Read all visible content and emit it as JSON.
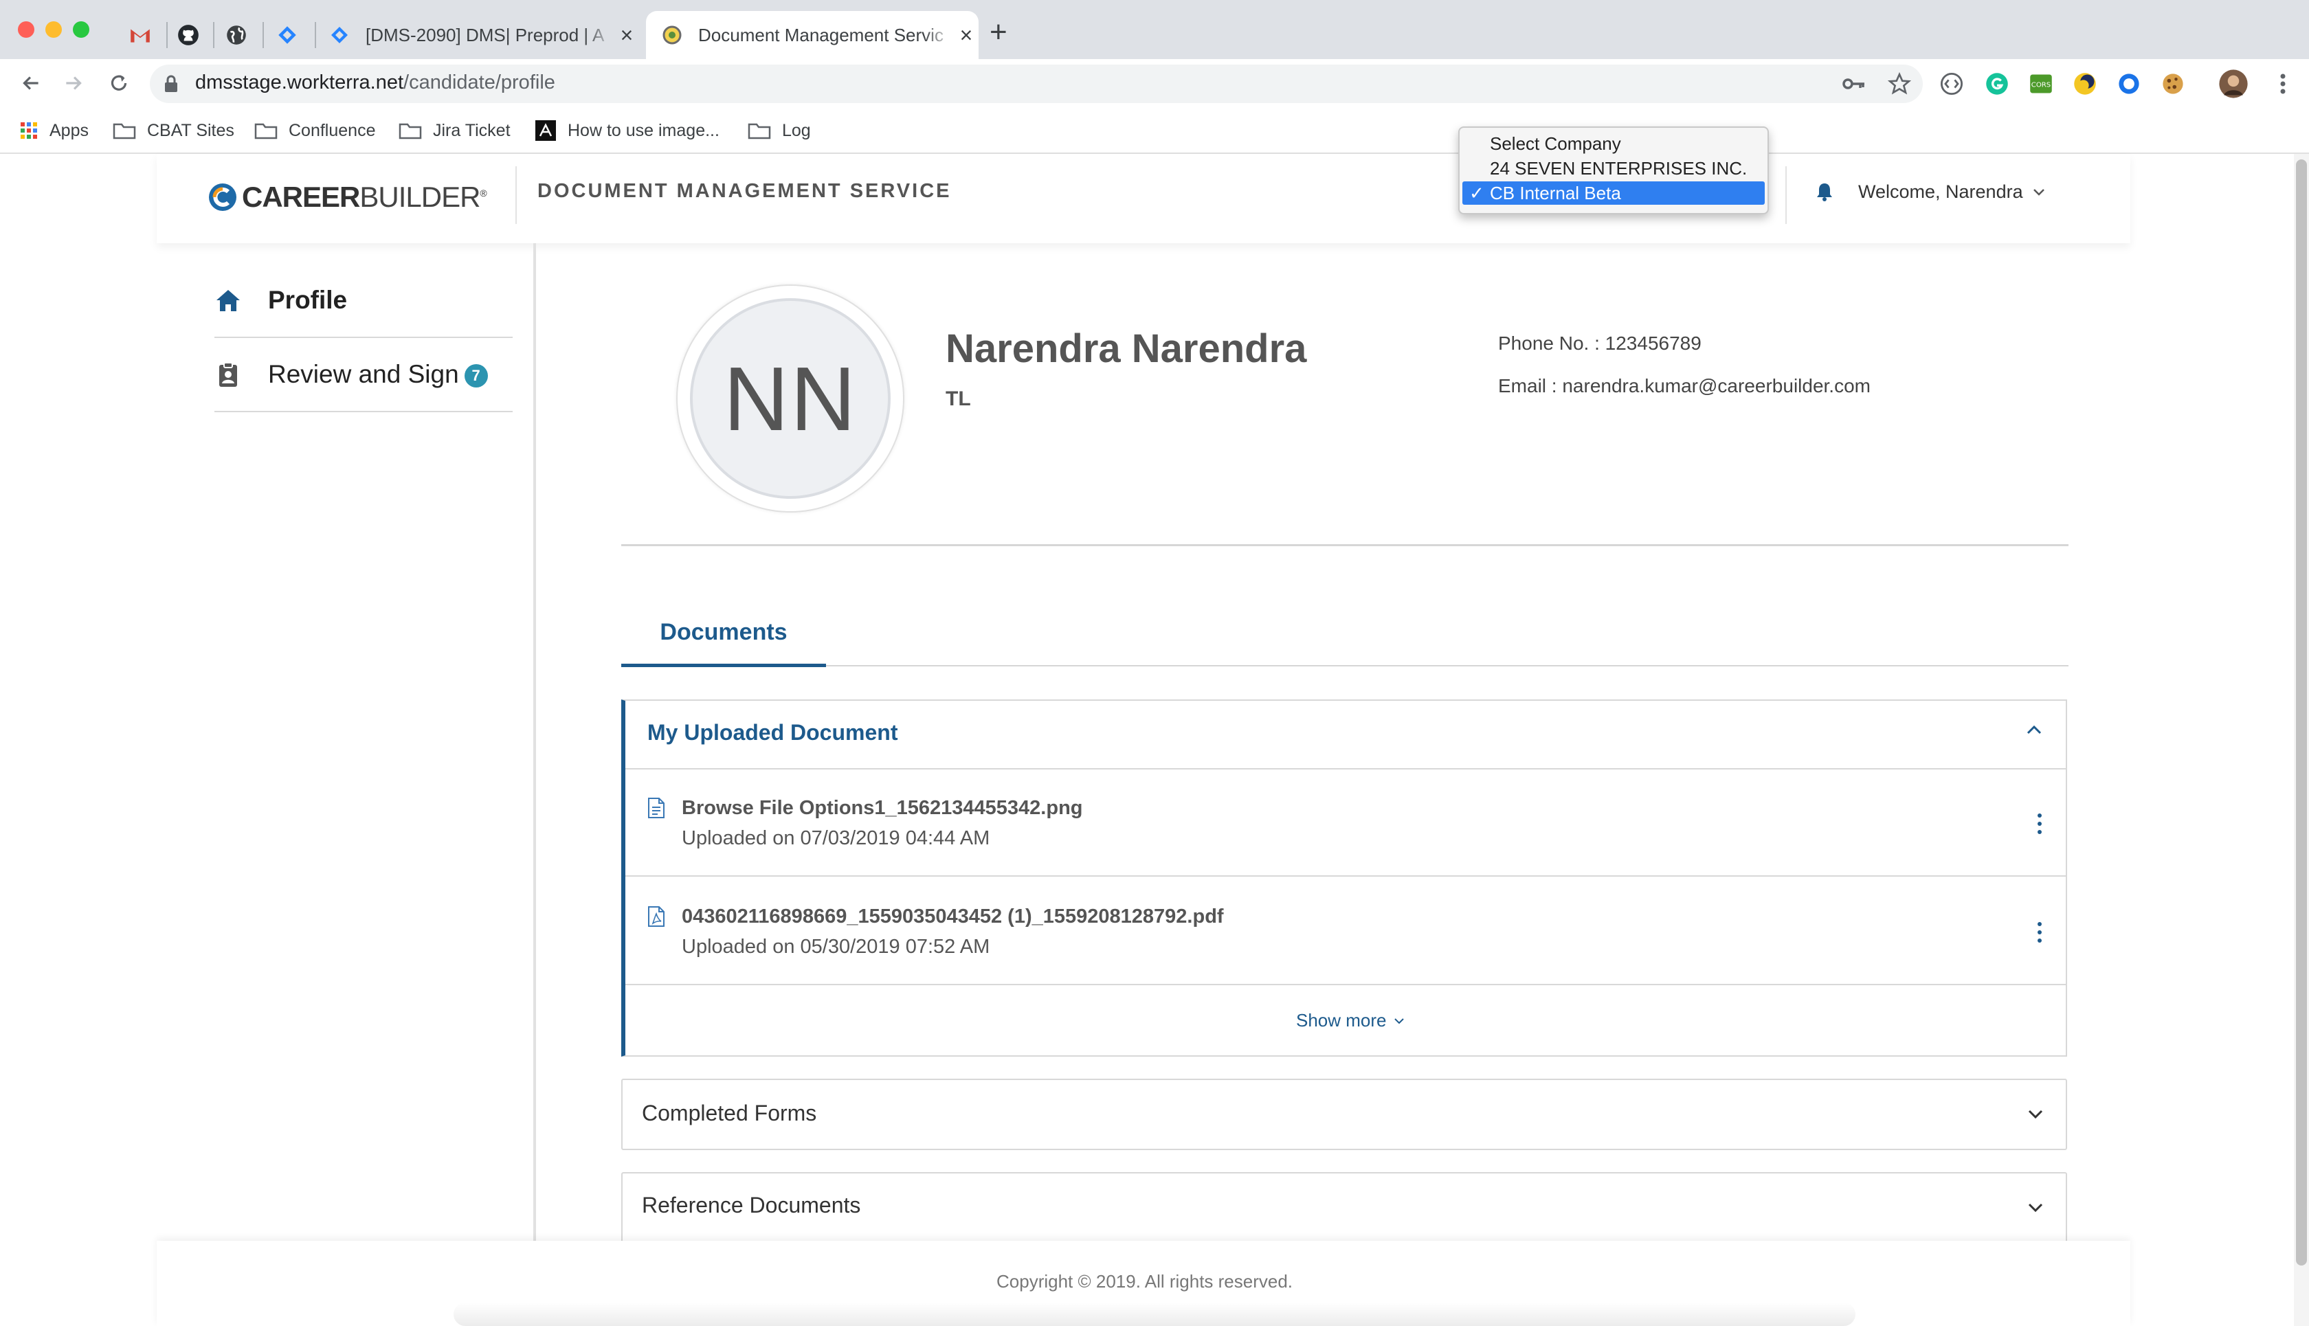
{
  "browser": {
    "tabs": [
      {
        "title": "[DMS-2090] DMS| Preprod | A",
        "favicon": "jira-icon"
      },
      {
        "title": "Document Management Servic",
        "favicon": "dms-globe-icon",
        "active": true
      }
    ],
    "pinned_tabs": [
      "gmail-icon",
      "github-icon",
      "globe-icon",
      "jira-icon"
    ],
    "new_tab_label": "+",
    "url": {
      "host": "dmsstage.workterra.net",
      "path": "/candidate/profile"
    },
    "bookmarks": [
      {
        "label": "Apps",
        "icon": "apps-grid-icon"
      },
      {
        "label": "CBAT Sites",
        "icon": "folder-icon"
      },
      {
        "label": "Confluence",
        "icon": "folder-icon"
      },
      {
        "label": "Jira Ticket",
        "icon": "folder-icon"
      },
      {
        "label": "How to use image...",
        "icon": "site-icon"
      },
      {
        "label": "Log",
        "icon": "folder-icon"
      }
    ]
  },
  "header": {
    "logo": {
      "bold": "CAREER",
      "light": "BUILDER",
      "mark": "®"
    },
    "app_title": "DOCUMENT MANAGEMENT SERVICE",
    "welcome": "Welcome, Narendra"
  },
  "company_select": {
    "options": [
      "Select Company",
      "24 SEVEN ENTERPRISES INC.",
      "CB Internal Beta"
    ],
    "selected": "CB Internal Beta",
    "check": "✓"
  },
  "sidebar": {
    "items": [
      {
        "label": "Profile",
        "icon": "home-icon"
      },
      {
        "label": "Review and Sign",
        "icon": "clipboard-user-icon",
        "badge": "7"
      }
    ]
  },
  "profile": {
    "initials": "NN",
    "name": "Narendra Narendra",
    "title": "TL",
    "phone": "Phone No. : 123456789",
    "email": "Email : narendra.kumar@careerbuilder.com"
  },
  "tabs": {
    "documents": "Documents"
  },
  "uploaded": {
    "title": "My Uploaded Document",
    "files": [
      {
        "name": "Browse File Options1_1562134455342.png",
        "date": "Uploaded on 07/03/2019 04:44 AM",
        "icon": "file-text-icon"
      },
      {
        "name": "043602116898669_1559035043452 (1)_1559208128792.pdf",
        "date": "Uploaded on 05/30/2019 07:52 AM",
        "icon": "file-pdf-icon"
      }
    ],
    "show_more": "Show more"
  },
  "sections": {
    "completed": "Completed Forms",
    "reference": "Reference Documents"
  },
  "footer": {
    "copyright": "Copyright © 2019. All rights reserved."
  },
  "colors": {
    "primary": "#1d5a8c",
    "badge": "#2c94b0",
    "select_highlight": "#2f7ff0"
  }
}
